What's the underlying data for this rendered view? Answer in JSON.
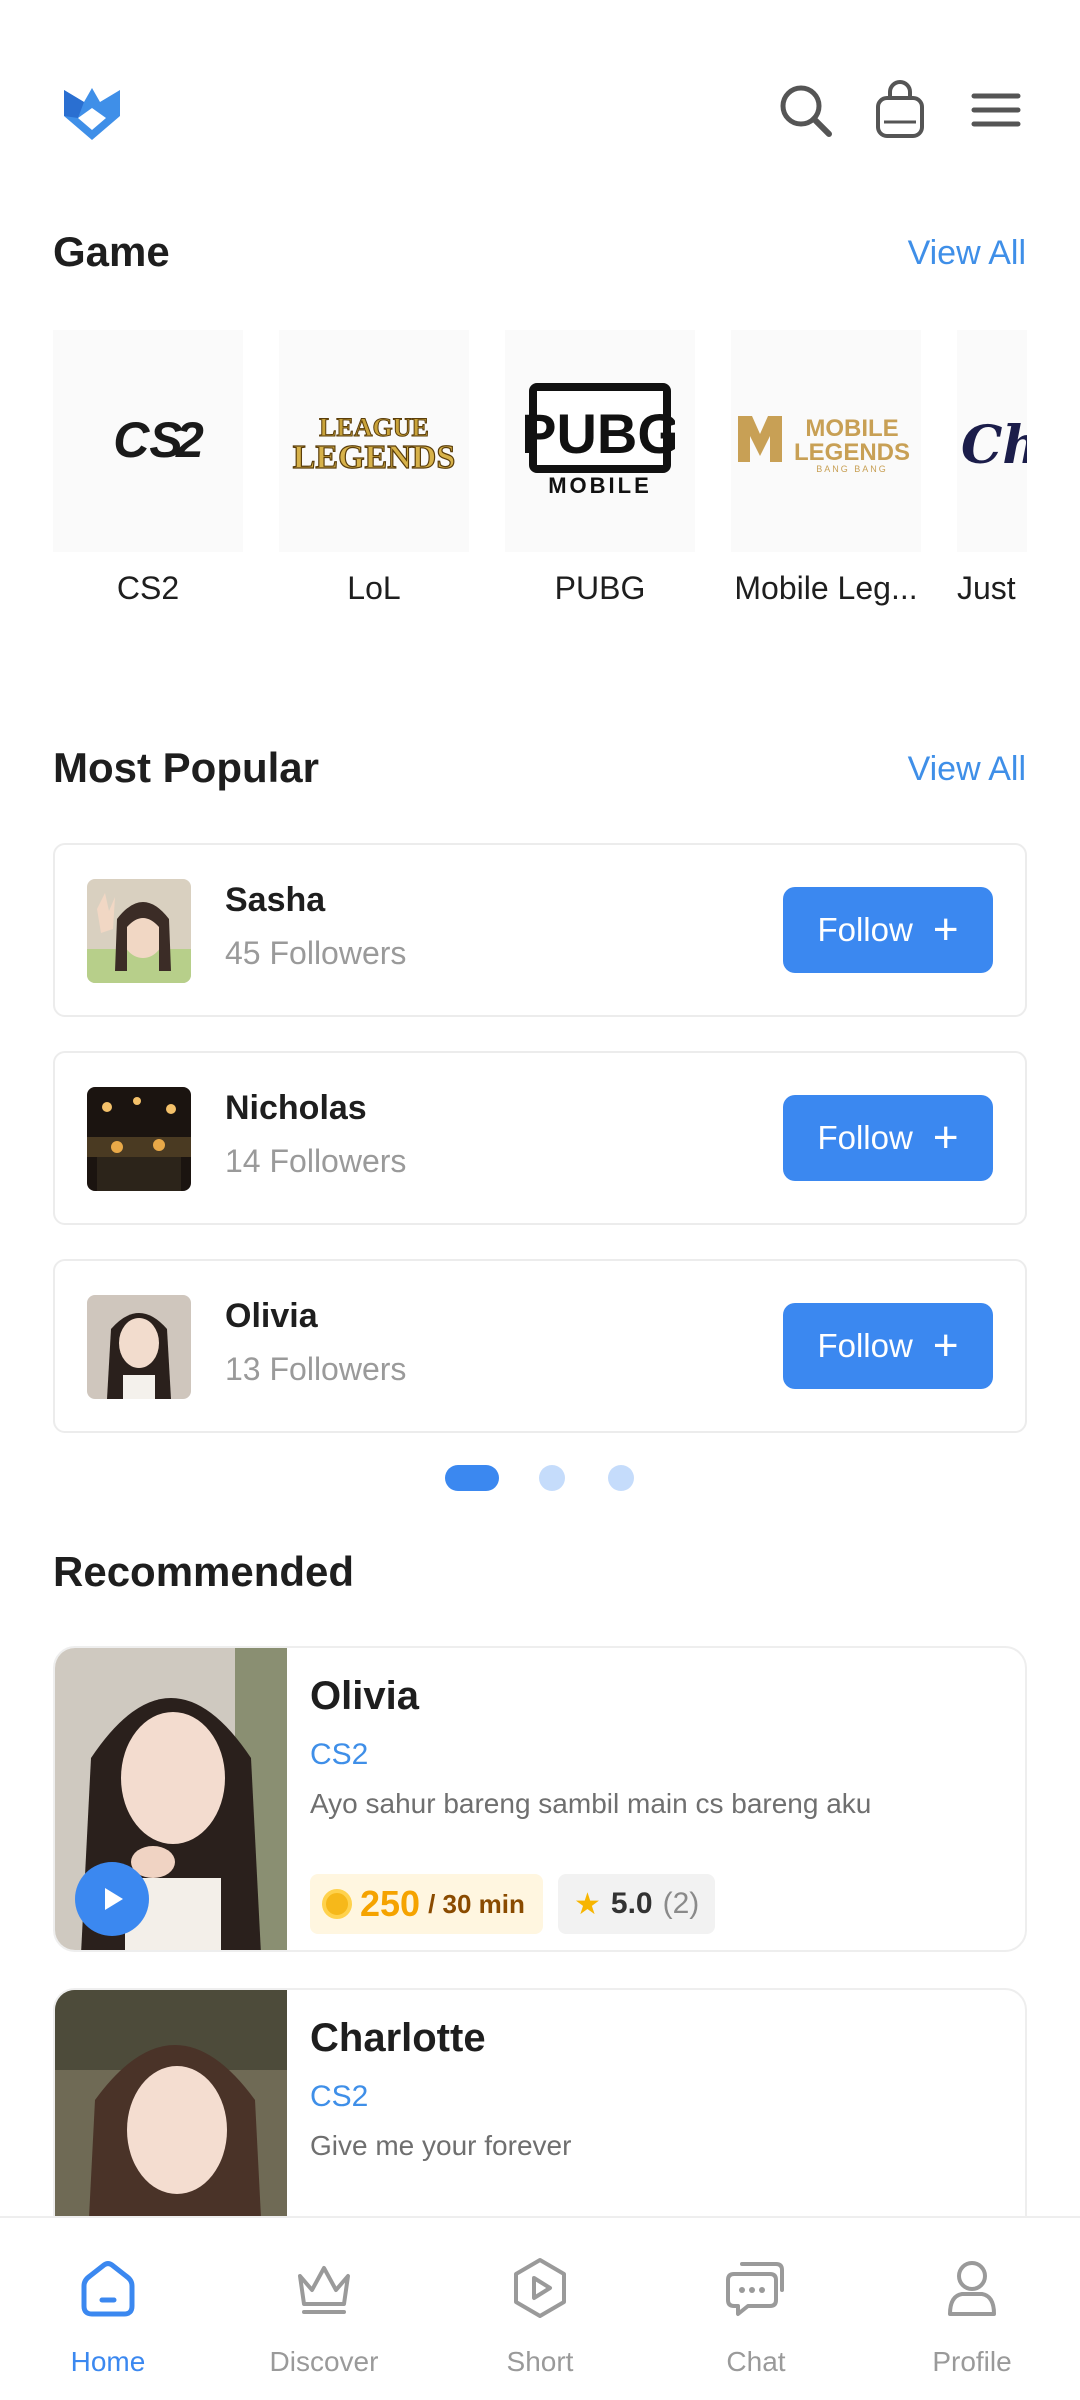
{
  "header": {
    "logo_icon": "brand-logo",
    "icons": [
      "search-icon",
      "bag-icon",
      "menu-icon"
    ]
  },
  "games_section": {
    "title": "Game",
    "view_all": "View All",
    "games": [
      {
        "name": "CS2",
        "logo": "cs2-logo"
      },
      {
        "name": "LoL",
        "logo": "league-of-legends-logo"
      },
      {
        "name": "PUBG",
        "logo": "pubg-mobile-logo"
      },
      {
        "name": "Mobile Leg...",
        "logo": "mobile-legends-logo"
      },
      {
        "name": "Just",
        "logo": "just-chatting-logo"
      }
    ],
    "logo_text": {
      "cs2": "CS",
      "lol_1": "LEAGUE",
      "lol_2": "LEGENDS",
      "pubg_1": "PUBG",
      "pubg_2": "MOBILE",
      "ml_1": "MOBILE",
      "ml_2": "LEGENDS",
      "ml_3": "BANG BANG",
      "just": "Ch"
    }
  },
  "popular_section": {
    "title": "Most Popular",
    "view_all": "View All",
    "users": [
      {
        "name": "Sasha",
        "followers": "45 Followers",
        "button": "Follow"
      },
      {
        "name": "Nicholas",
        "followers": "14 Followers",
        "button": "Follow"
      },
      {
        "name": "Olivia",
        "followers": "13 Followers",
        "button": "Follow"
      }
    ],
    "pagination": {
      "pages": 3,
      "active": 1
    }
  },
  "recommended_section": {
    "title": "Recommended",
    "items": [
      {
        "name": "Olivia",
        "game": "CS2",
        "description": "Ayo sahur bareng sambil main cs bareng aku",
        "price": "250",
        "price_unit": "/ 30 min",
        "rating": "5.0",
        "rating_count": "(2)"
      },
      {
        "name": "Charlotte",
        "game": "CS2",
        "description": "Give me your forever"
      }
    ]
  },
  "bottom_nav": {
    "active": "Home",
    "items": [
      {
        "label": "Home",
        "icon": "home-icon"
      },
      {
        "label": "Discover",
        "icon": "crown-icon"
      },
      {
        "label": "Short",
        "icon": "play-hexagon-icon"
      },
      {
        "label": "Chat",
        "icon": "chat-icon"
      },
      {
        "label": "Profile",
        "icon": "profile-icon"
      }
    ]
  },
  "colors": {
    "accent": "#3b88f0",
    "link": "#3f8fe8",
    "text": "#1e1e1e",
    "muted": "#9a9a9a",
    "price": "#f5a300"
  }
}
